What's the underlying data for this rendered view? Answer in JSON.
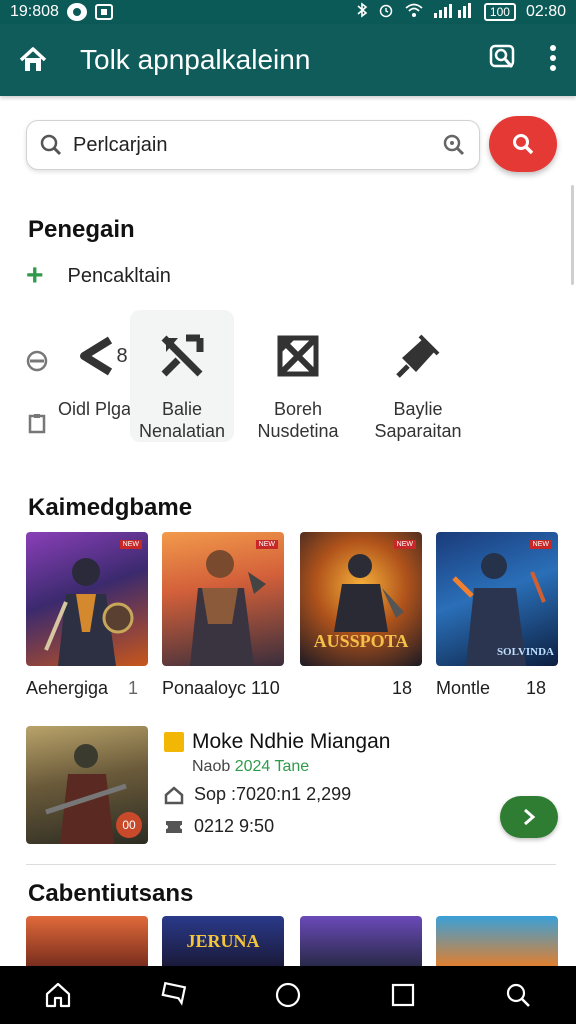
{
  "status_bar": {
    "time_left": "19:808",
    "battery": "100",
    "time_right": "02:80"
  },
  "app_bar": {
    "title": "Tolk apnpalkaleinn"
  },
  "search": {
    "value": "Perlcarjain"
  },
  "section1": {
    "title": "Penegain",
    "add_label": "Pencakltain"
  },
  "categories": [
    {
      "label": "Oidl Plgam",
      "badge": "8"
    },
    {
      "label": "Balie Nenalatian"
    },
    {
      "label": "Boreh Nusdetina"
    },
    {
      "label": "Baylie Saparaitan"
    }
  ],
  "section2": {
    "title": "Kaimedgbame"
  },
  "games": [
    {
      "caption": "Aehergiga",
      "meta": "1",
      "tag": "NEW",
      "art_text": ""
    },
    {
      "caption": "Ponaaloyc 110",
      "meta": "",
      "tag": "NEW",
      "art_text": ""
    },
    {
      "caption": "",
      "meta": "18",
      "tag": "NEW",
      "art_text": "AUSSPOTA"
    },
    {
      "caption": "Montle",
      "meta": "18",
      "tag": "NEW",
      "art_text": "SOLVINDA"
    }
  ],
  "featured": {
    "title": "Moke Ndhie Miangan",
    "subtitle_prefix": "Naob ",
    "subtitle_highlight": "2024 Tane",
    "line1": "Sop :7020:n1 2,299",
    "line2": "0212 9:50",
    "badge": "00"
  },
  "section3": {
    "title": "Cabentiutsans"
  },
  "bottom_banner_text": "JERUNA",
  "colors": {
    "primary": "#0f5c5a",
    "accent_red": "#e53935",
    "accent_green": "#2e7d32"
  }
}
